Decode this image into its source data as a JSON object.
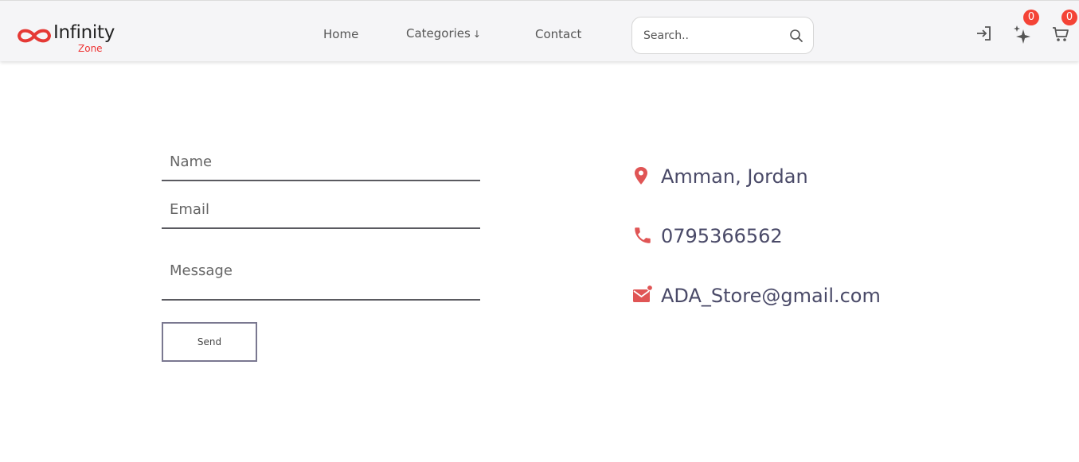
{
  "brand": {
    "name": "Infinity",
    "sub": "Zone",
    "accent": "#e53935"
  },
  "nav": {
    "home": "Home",
    "categories": "Categories",
    "categories_arrow": "↓",
    "contact": "Contact"
  },
  "search": {
    "placeholder": "Search.."
  },
  "header_icons": {
    "login": "login-icon",
    "wishlist": "sparkle-icon",
    "wishlist_count": "0",
    "cart": "cart-icon",
    "cart_count": "0"
  },
  "form": {
    "name_placeholder": "Name",
    "email_placeholder": "Email",
    "message_placeholder": "Message",
    "send_label": "Send"
  },
  "contact": {
    "address": "Amman, Jordan",
    "phone": "0795366562",
    "email": "ADA_Store@gmail.com",
    "icon_color": "#e05555"
  }
}
